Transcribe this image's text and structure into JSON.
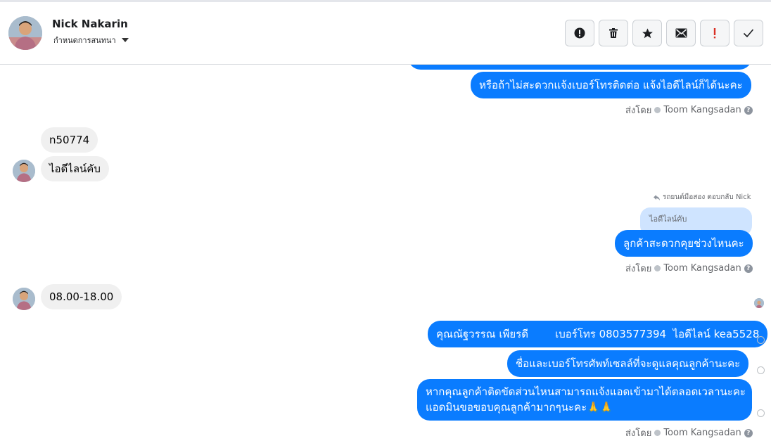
{
  "header": {
    "name": "Nick Nakarin",
    "assign_label": "กำหนดการสนทนา",
    "toolbar": [
      {
        "icon": "alert-circle-icon"
      },
      {
        "icon": "trash-icon"
      },
      {
        "icon": "star-icon"
      },
      {
        "icon": "envelope-icon"
      },
      {
        "icon": "exclamation-icon",
        "color": "#d93025"
      },
      {
        "icon": "checkmark-icon"
      }
    ]
  },
  "messages": {
    "m1": "หรือถ้าไม่สะดวกแจ้งเบอร์โทรติดต่อ แจ้งไอดีไลน์ก็ได้นะคะ",
    "sent_prefix": "ส่งโดย",
    "agent": "Toom Kangsadan",
    "in1": "n50774",
    "in2": "ไอดีไลน์คับ",
    "reply_meta": "รถยนต์มือสอง ตอบกลับ Nick",
    "quoted": "ไอดีไลน์คับ",
    "m2": "ลูกค้าสะดวกคุยช่วงไหนคะ",
    "in3": "08.00-18.00",
    "m3": "คุณณัฐวรรณ เพียรดี        เบอร์โทร 0803577394  ไอดีไลน์ kea5528",
    "m4": "ชื่อและเบอร์โทรศัพท์เซลล์ที่จะดูแลคุณลูกค้านะคะ",
    "m5_line1": "หากคุณลูกค้าติดขัดส่วนไหนสามารถแจ้งแอดเข้ามาได้ตลอดเวลานะคะ",
    "m5_line2": "แอดมินขอขอบคุณลูกค้ามากๆนะคะ🙏🙏"
  },
  "colors": {
    "outgoing_bubble": "#0a7cff",
    "incoming_bubble": "#f0f0f0",
    "quoted_bubble": "#cfe4ff"
  }
}
